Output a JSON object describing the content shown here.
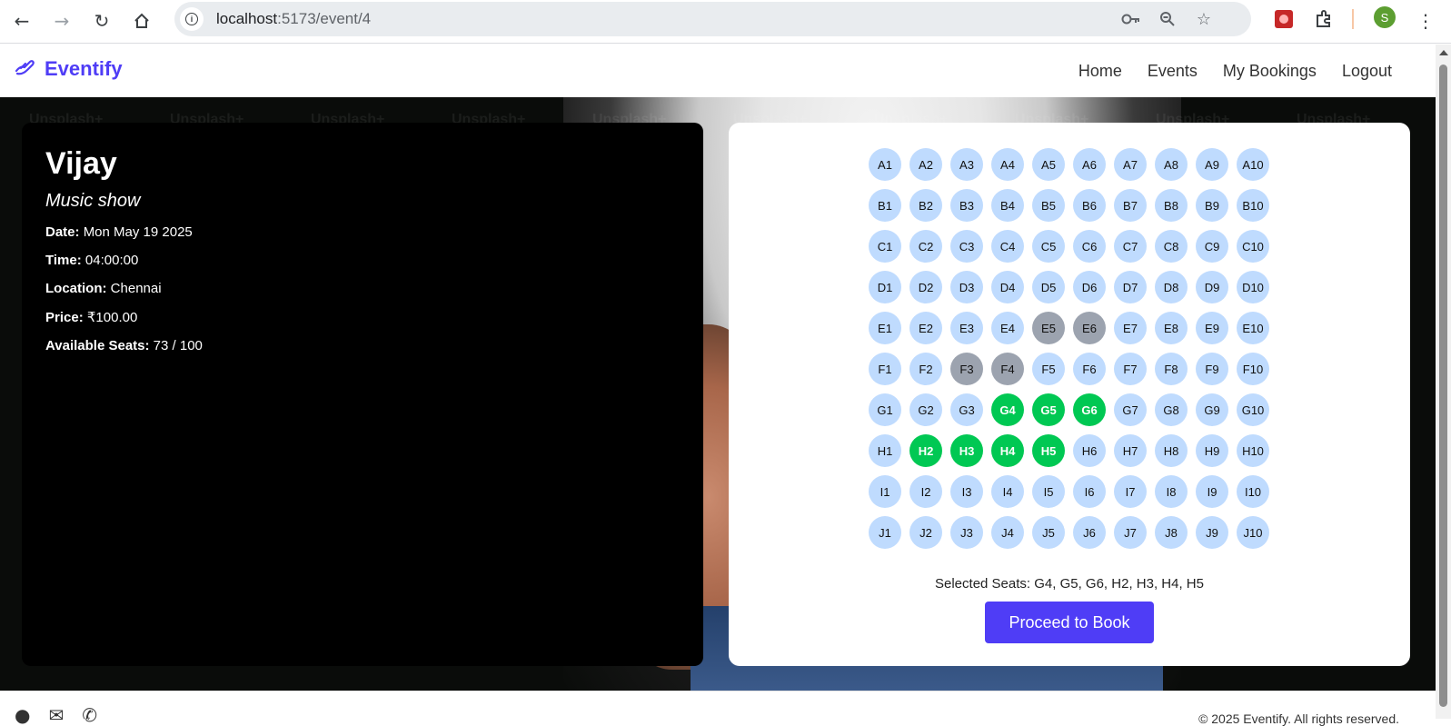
{
  "browser": {
    "url_host": "localhost",
    "url_path": ":5173/event/4",
    "avatar_letter": "S"
  },
  "nav": {
    "brand": "Eventify",
    "links": [
      "Home",
      "Events",
      "My Bookings",
      "Logout"
    ]
  },
  "event": {
    "title": "Vijay",
    "category": "Music show",
    "date_label": "Date:",
    "date": "Mon May 19 2025",
    "time_label": "Time:",
    "time": "04:00:00",
    "location_label": "Location:",
    "location": "Chennai",
    "price_label": "Price:",
    "price": "₹100.00",
    "seats_label": "Available Seats:",
    "seats": "73 / 100"
  },
  "seating": {
    "rows": [
      "A",
      "B",
      "C",
      "D",
      "E",
      "F",
      "G",
      "H",
      "I",
      "J"
    ],
    "columns": 10,
    "booked": [
      "E5",
      "E6",
      "F3",
      "F4"
    ],
    "selected": [
      "G4",
      "G5",
      "G6",
      "H2",
      "H3",
      "H4",
      "H5"
    ],
    "selected_text": "Selected Seats: G4, G5, G6, H2, H3, H4, H5",
    "book_button": "Proceed to Book"
  },
  "watermark": "Unsplash+",
  "footer": {
    "copyright": "© 2025 Eventify. All rights reserved."
  },
  "colors": {
    "accent": "#4f3df6",
    "seat_available": "#bfdbfe",
    "seat_booked": "#9ca3af",
    "seat_selected": "#00c853"
  }
}
